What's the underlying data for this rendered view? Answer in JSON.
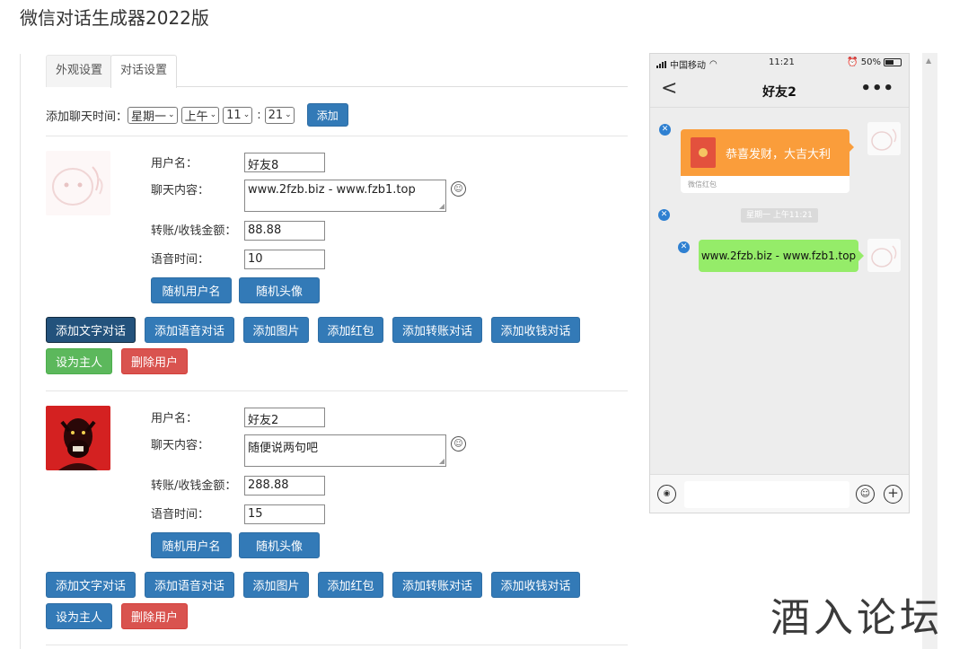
{
  "page": {
    "title": "微信对话生成器2022版"
  },
  "tabs": [
    {
      "label": "外观设置"
    },
    {
      "label": "对话设置"
    }
  ],
  "add_time": {
    "label": "添加聊天时间：",
    "weekday": "星期一",
    "period": "上午",
    "hour": "11",
    "separator": ":",
    "minute": "21",
    "button": "添加"
  },
  "field_labels": {
    "username": "用户名：",
    "content": "聊天内容：",
    "amount": "转账/收钱金额：",
    "voice_time": "语音时间："
  },
  "buttons": {
    "random_name": "随机用户名",
    "random_avatar": "随机头像",
    "add_text": "添加文字对话",
    "add_voice": "添加语音对话",
    "add_image": "添加图片",
    "add_redpacket": "添加红包",
    "add_transfer": "添加转账对话",
    "add_receive": "添加收钱对话",
    "set_owner": "设为主人",
    "delete_user": "删除用户"
  },
  "users": [
    {
      "username": "好友8",
      "content": "www.2fzb.biz - www.fzb1.top",
      "amount": "88.88",
      "voice_time": "10"
    },
    {
      "username": "好友2",
      "content": "随便说两句吧",
      "amount": "288.88",
      "voice_time": "15"
    }
  ],
  "phone": {
    "status": {
      "carrier": "中国移动",
      "time": "11:21",
      "battery": "50%"
    },
    "nav": {
      "back": "<",
      "title": "好友2",
      "more": "•••"
    },
    "messages": {
      "redpacket_text": "恭喜发财，大吉大利",
      "redpacket_sub": "微信红包",
      "time_tag": "星期一 上午11:21",
      "text_bubble": "www.2fzb.biz - www.fzb1.top"
    }
  },
  "watermark": "酒入论坛",
  "colors": {
    "primary": "#337ab7",
    "primary_active": "#23527c",
    "success": "#5cb85c",
    "danger": "#d9534f",
    "redpacket": "#fa9d3b",
    "bubble_green": "#95ec69",
    "delete_dot": "#2f80d1"
  },
  "icons": {
    "emoji": "smiley-icon",
    "back": "chevron-left-icon",
    "more": "more-dots-icon",
    "voice": "voice-icon",
    "plus": "plus-icon",
    "delete": "close-icon"
  }
}
